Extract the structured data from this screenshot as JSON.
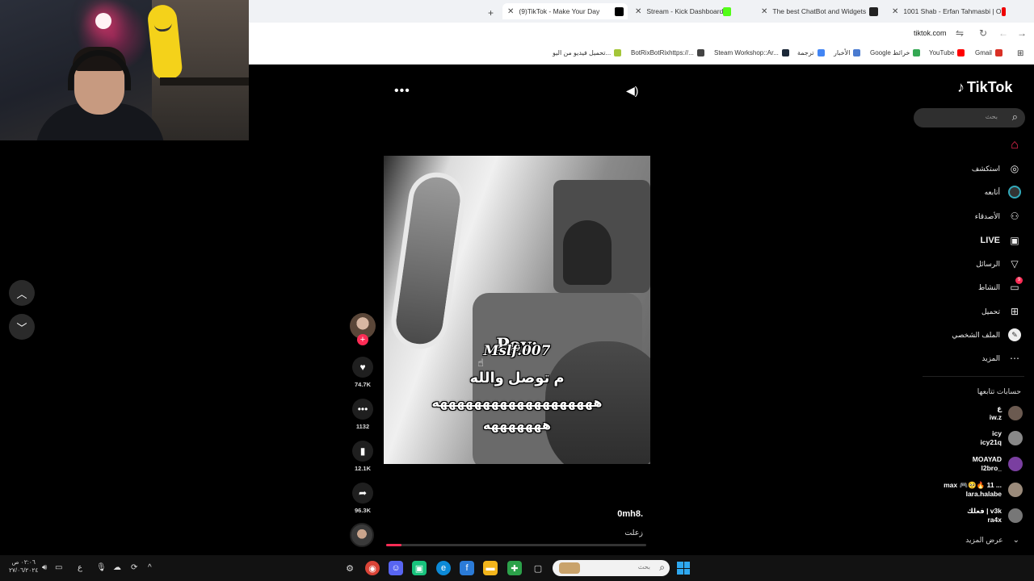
{
  "browser": {
    "new_tab": "+",
    "tabs": [
      {
        "title": "(9)TikTok - Make Your Day",
        "favicon_color": "#000000",
        "active": true
      },
      {
        "title": "Stream - Kick Dashboard",
        "favicon_color": "#000000",
        "active": false
      },
      {
        "title": "The best ChatBot and Widgets",
        "favicon_color": "#53fc18",
        "active": false
      },
      {
        "title": "1001 Shab - Erfan Tahmasbi | O",
        "favicon_color": "#222222",
        "active": false
      }
    ],
    "url": "tiktok.com",
    "bookmarks": [
      {
        "label": "Gmail",
        "color": "#d93025"
      },
      {
        "label": "YouTube",
        "color": "#ff0000"
      },
      {
        "label": "Google خرائط",
        "color": "#34a853"
      },
      {
        "label": "الأخبار",
        "color": "#4a7bd0"
      },
      {
        "label": "ترجمة",
        "color": "#4285f4"
      },
      {
        "label": "Steam Workshop::Ar...",
        "color": "#1b2838"
      },
      {
        "label": "BotRixBotRixhttps://...",
        "color": "#444444"
      },
      {
        "label": "تحميل فيديو من اليو...",
        "color": "#a4c639"
      }
    ]
  },
  "tiktok": {
    "logo": "TikTok",
    "search_placeholder": "بحث",
    "nav": [
      {
        "label": "",
        "icon": "home-icon",
        "glyph": "⌂",
        "color": "#fe2c55"
      },
      {
        "label": "استكشف",
        "icon": "compass-icon",
        "glyph": "◎"
      },
      {
        "label": "أتابعه",
        "icon": "avatar-ring-icon",
        "glyph": "◉"
      },
      {
        "label": "الأصدقاء",
        "icon": "friends-icon",
        "glyph": "👤"
      },
      {
        "label": "LIVE",
        "icon": "live-icon",
        "glyph": "▣"
      },
      {
        "label": "الرسائل",
        "icon": "messages-icon",
        "glyph": "▽"
      },
      {
        "label": "النشاط",
        "icon": "activity-icon",
        "glyph": "▭",
        "badge": "9"
      },
      {
        "label": "تحميل",
        "icon": "upload-icon",
        "glyph": "⊞"
      },
      {
        "label": "الملف الشخصي",
        "icon": "profile-icon",
        "glyph": "●"
      },
      {
        "label": "المزيد",
        "icon": "more-icon",
        "glyph": "⋯"
      }
    ],
    "following_title": "حسابات تتابعها",
    "accounts": [
      {
        "name": "ع",
        "handle": "iw.z",
        "color": "#6b5a50"
      },
      {
        "name": "icy",
        "handle": "icy21q",
        "color": "#888888"
      },
      {
        "name": "MOAYAD",
        "handle": "l2bro_",
        "color": "#7a3fa0"
      },
      {
        "name": "max 🎮🥺🔥 11 ...",
        "handle": "lara.halabe",
        "color": "#9a8a7a"
      },
      {
        "name": "فعلك | v3k",
        "handle": "ra4x",
        "color": "#777777"
      }
    ],
    "show_more": "عرض المزيد",
    "video": {
      "caption_pov": "Pov:",
      "caption_user": "Mslf.007",
      "caption_line1": "م توصل والله",
      "caption_line2": "هههههههههههههههههههه",
      "caption_line3": "هههههههه",
      "author": "0mh8.",
      "description": "زعلت",
      "progress": 0.06
    },
    "actions": {
      "likes": "74.7K",
      "comments": "1132",
      "bookmarks": "12.1K",
      "shares": "96.3K"
    }
  },
  "taskbar": {
    "search_placeholder": "بحث",
    "clock_time": "٠٢:٠٦ ص",
    "clock_date": "٢٧/٠٦/٢٠٢٤",
    "lang": "ع"
  }
}
